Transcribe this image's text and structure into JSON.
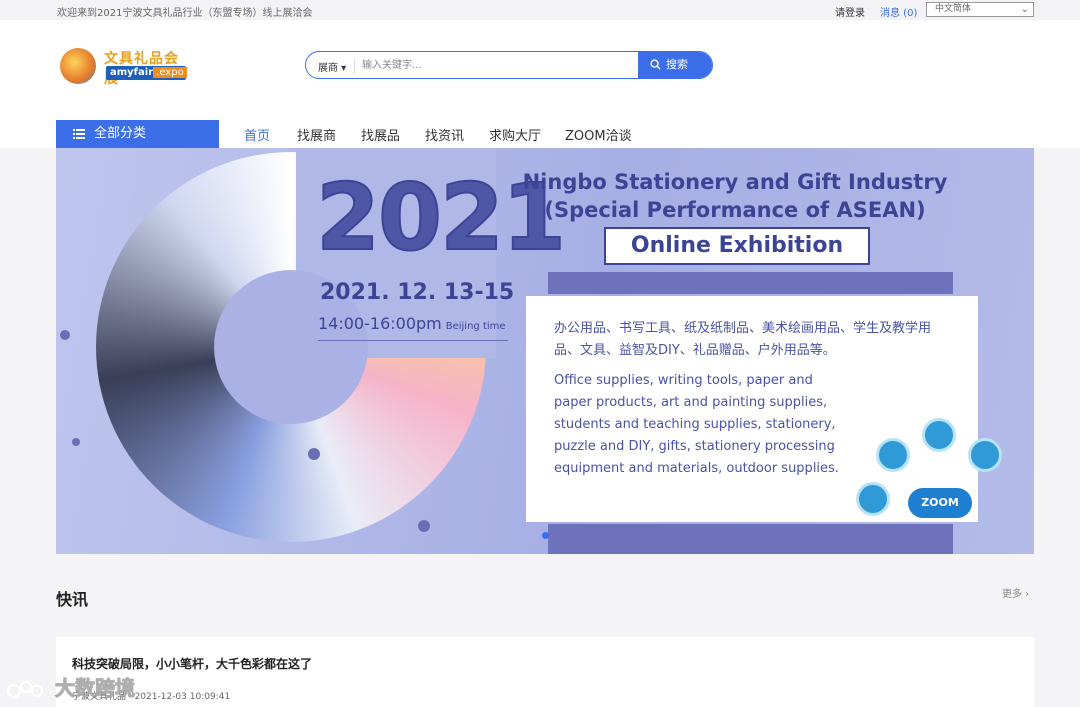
{
  "topbar": {
    "welcome": "欢迎来到2021宁波文具礼品行业（东盟专场）线上展洽会",
    "login": "请登录",
    "messages": "消息 (0)",
    "language": "中文简体"
  },
  "logo": {
    "cn": "文具礼品会展",
    "en_a": "amyfair",
    "en_b": ".expo"
  },
  "search": {
    "scope": "展商",
    "placeholder": "输入关键字...",
    "button": "搜索"
  },
  "nav": {
    "all_categories": "全部分类",
    "items": [
      "首页",
      "找展商",
      "找展品",
      "找资讯",
      "求购大厅",
      "ZOOM洽谈"
    ]
  },
  "banner": {
    "year": "2021",
    "date": "2021. 12. 13-15",
    "time": "14:00-16:00pm",
    "timezone": "Beijing time",
    "title_line1": "Ningbo Stationery and Gift Industry",
    "title_line2": "(Special Performance of ASEAN)",
    "title_line3": "Online Exhibition",
    "desc_cn": "办公用品、书写工具、纸及纸制品、美术绘画用品、学生及教学用品、文具、益智及DIY、礼品赠品、户外用品等。",
    "desc_en": "Office supplies, writing tools, paper and paper products, art and painting supplies, students and teaching supplies, stationery, puzzle and DIY, gifts, stationery processing equipment and materials, outdoor supplies.",
    "zoom": "ZOOM"
  },
  "news": {
    "title": "快讯",
    "more": "更多 ›",
    "items": [
      {
        "headline": "科技突破局限，小小笔杆，大千色彩都在这了",
        "meta": "宁波文具礼品 · 2021-12-03 10:09:41"
      }
    ]
  },
  "watermark": "大数跨境"
}
